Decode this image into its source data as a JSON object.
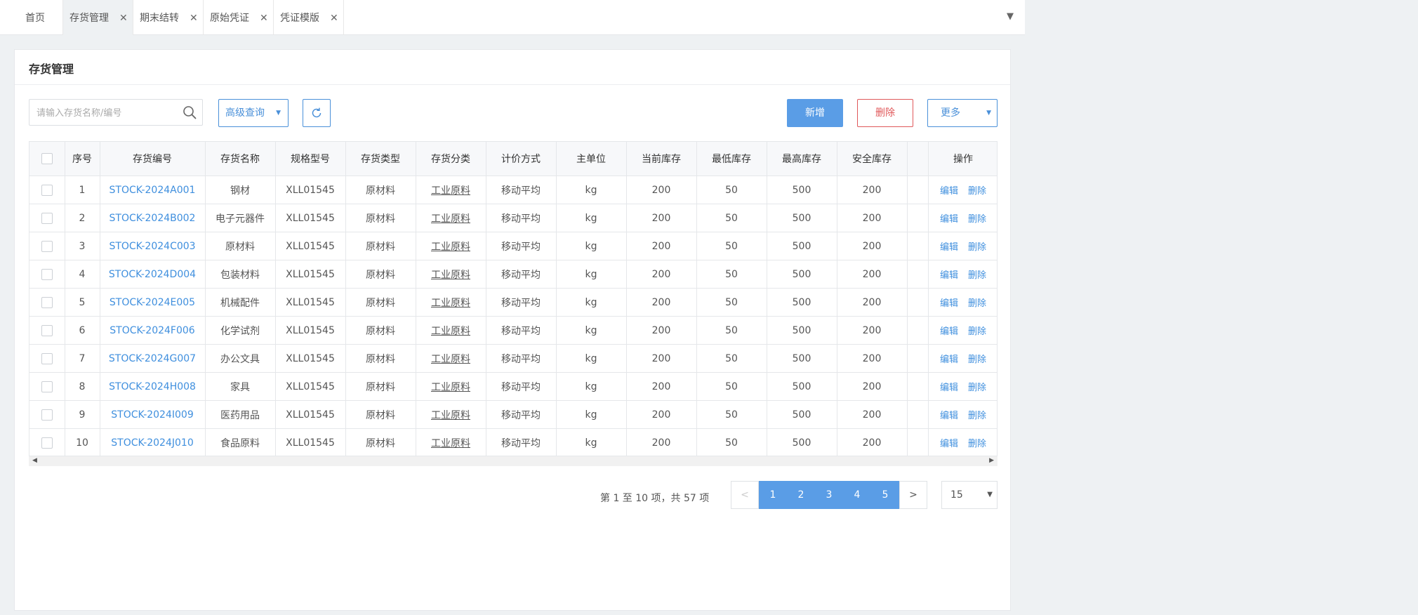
{
  "tabs": [
    {
      "label": "首页",
      "closable": false
    },
    {
      "label": "存货管理",
      "closable": true,
      "active": true
    },
    {
      "label": "期末结转",
      "closable": true
    },
    {
      "label": "原始凭证",
      "closable": true
    },
    {
      "label": "凭证模版",
      "closable": true
    }
  ],
  "panel": {
    "title": "存货管理"
  },
  "toolbar": {
    "search_placeholder": "请输入存货名称/编号",
    "advanced_label": "高级查询",
    "new_label": "新增",
    "delete_label": "删除",
    "more_label": "更多"
  },
  "table": {
    "columns": [
      "序号",
      "存货编号",
      "存货名称",
      "规格型号",
      "存货类型",
      "存货分类",
      "计价方式",
      "主单位",
      "当前库存",
      "最低库存",
      "最高库存",
      "安全库存",
      "",
      "操作"
    ],
    "edit_label": "编辑",
    "delete_label": "删除",
    "rows": [
      [
        "1",
        "STOCK-2024A001",
        "钢材",
        "XLL01545",
        "原材料",
        "工业原料",
        "移动平均",
        "kg",
        "200",
        "50",
        "500",
        "200"
      ],
      [
        "2",
        "STOCK-2024B002",
        "电子元器件",
        "XLL01545",
        "原材料",
        "工业原料",
        "移动平均",
        "kg",
        "200",
        "50",
        "500",
        "200"
      ],
      [
        "3",
        "STOCK-2024C003",
        "原材料",
        "XLL01545",
        "原材料",
        "工业原料",
        "移动平均",
        "kg",
        "200",
        "50",
        "500",
        "200"
      ],
      [
        "4",
        "STOCK-2024D004",
        "包装材料",
        "XLL01545",
        "原材料",
        "工业原料",
        "移动平均",
        "kg",
        "200",
        "50",
        "500",
        "200"
      ],
      [
        "5",
        "STOCK-2024E005",
        "机械配件",
        "XLL01545",
        "原材料",
        "工业原料",
        "移动平均",
        "kg",
        "200",
        "50",
        "500",
        "200"
      ],
      [
        "6",
        "STOCK-2024F006",
        "化学试剂",
        "XLL01545",
        "原材料",
        "工业原料",
        "移动平均",
        "kg",
        "200",
        "50",
        "500",
        "200"
      ],
      [
        "7",
        "STOCK-2024G007",
        "办公文具",
        "XLL01545",
        "原材料",
        "工业原料",
        "移动平均",
        "kg",
        "200",
        "50",
        "500",
        "200"
      ],
      [
        "8",
        "STOCK-2024H008",
        "家具",
        "XLL01545",
        "原材料",
        "工业原料",
        "移动平均",
        "kg",
        "200",
        "50",
        "500",
        "200"
      ],
      [
        "9",
        "STOCK-2024I009",
        "医药用品",
        "XLL01545",
        "原材料",
        "工业原料",
        "移动平均",
        "kg",
        "200",
        "50",
        "500",
        "200"
      ],
      [
        "10",
        "STOCK-2024J010",
        "食品原料",
        "XLL01545",
        "原材料",
        "工业原料",
        "移动平均",
        "kg",
        "200",
        "50",
        "500",
        "200"
      ]
    ]
  },
  "pagination": {
    "info": "第 1 至 10 项，共 57 项",
    "prev": "<",
    "next": ">",
    "pages": [
      "1",
      "2",
      "3",
      "4",
      "5"
    ],
    "page_size": "15"
  },
  "colors": {
    "accent": "#5a9de6",
    "link": "#3f8fde",
    "danger": "#e0585a"
  }
}
